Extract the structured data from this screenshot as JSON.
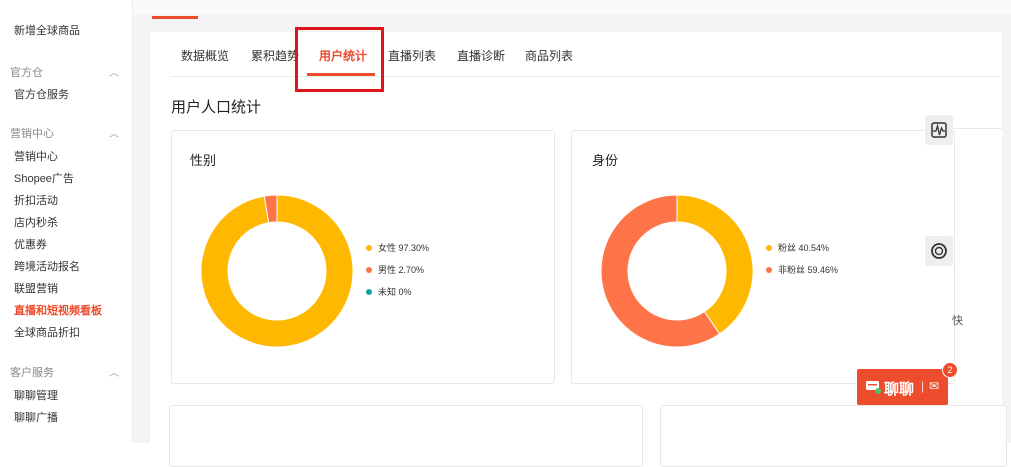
{
  "sidebar": {
    "top_item": "新增全球商品",
    "groups": [
      {
        "title": "官方仓",
        "items": [
          "官方仓服务"
        ]
      },
      {
        "title": "营销中心",
        "items": [
          "营销中心",
          "Shopee广告",
          "折扣活动",
          "店内秒杀",
          "优惠券",
          "跨境活动报名",
          "联盟营销",
          "直播和短视频看板",
          "全球商品折扣"
        ]
      },
      {
        "title": "客户服务",
        "items": [
          "聊聊管理",
          "聊聊广播"
        ]
      }
    ],
    "active_item": "直播和短视频看板"
  },
  "tabs": [
    "数据概览",
    "累积趋势",
    "用户统计",
    "直播列表",
    "直播诊断",
    "商品列表"
  ],
  "active_tab": "用户统计",
  "section_title": "用户人口统计",
  "cards": [
    {
      "title": "性别",
      "chart_data": {
        "type": "pie",
        "style": "donut",
        "categories": [
          "女性",
          "男性",
          "未知"
        ],
        "values": [
          97.3,
          2.7,
          0
        ],
        "labels": [
          "女性 97.30%",
          "男性 2.70%",
          "未知 0%"
        ],
        "colors": [
          "#ffb800",
          "#ff7348",
          "#17a2a2"
        ]
      }
    },
    {
      "title": "身份",
      "chart_data": {
        "type": "pie",
        "style": "donut",
        "categories": [
          "粉丝",
          "非粉丝"
        ],
        "values": [
          40.54,
          59.46
        ],
        "labels": [
          "粉丝 40.54%",
          "非粉丝 59.46%"
        ],
        "colors": [
          "#ffb800",
          "#ff7348"
        ]
      }
    }
  ],
  "float_tools": [
    "waveform-icon",
    "headset-icon"
  ],
  "right_edge_text": "快",
  "chat": {
    "label": "聊聊",
    "extra": "✉",
    "badge": "2"
  },
  "colors": {
    "accent": "#ee4d2d",
    "highlight": "#e0141b"
  }
}
